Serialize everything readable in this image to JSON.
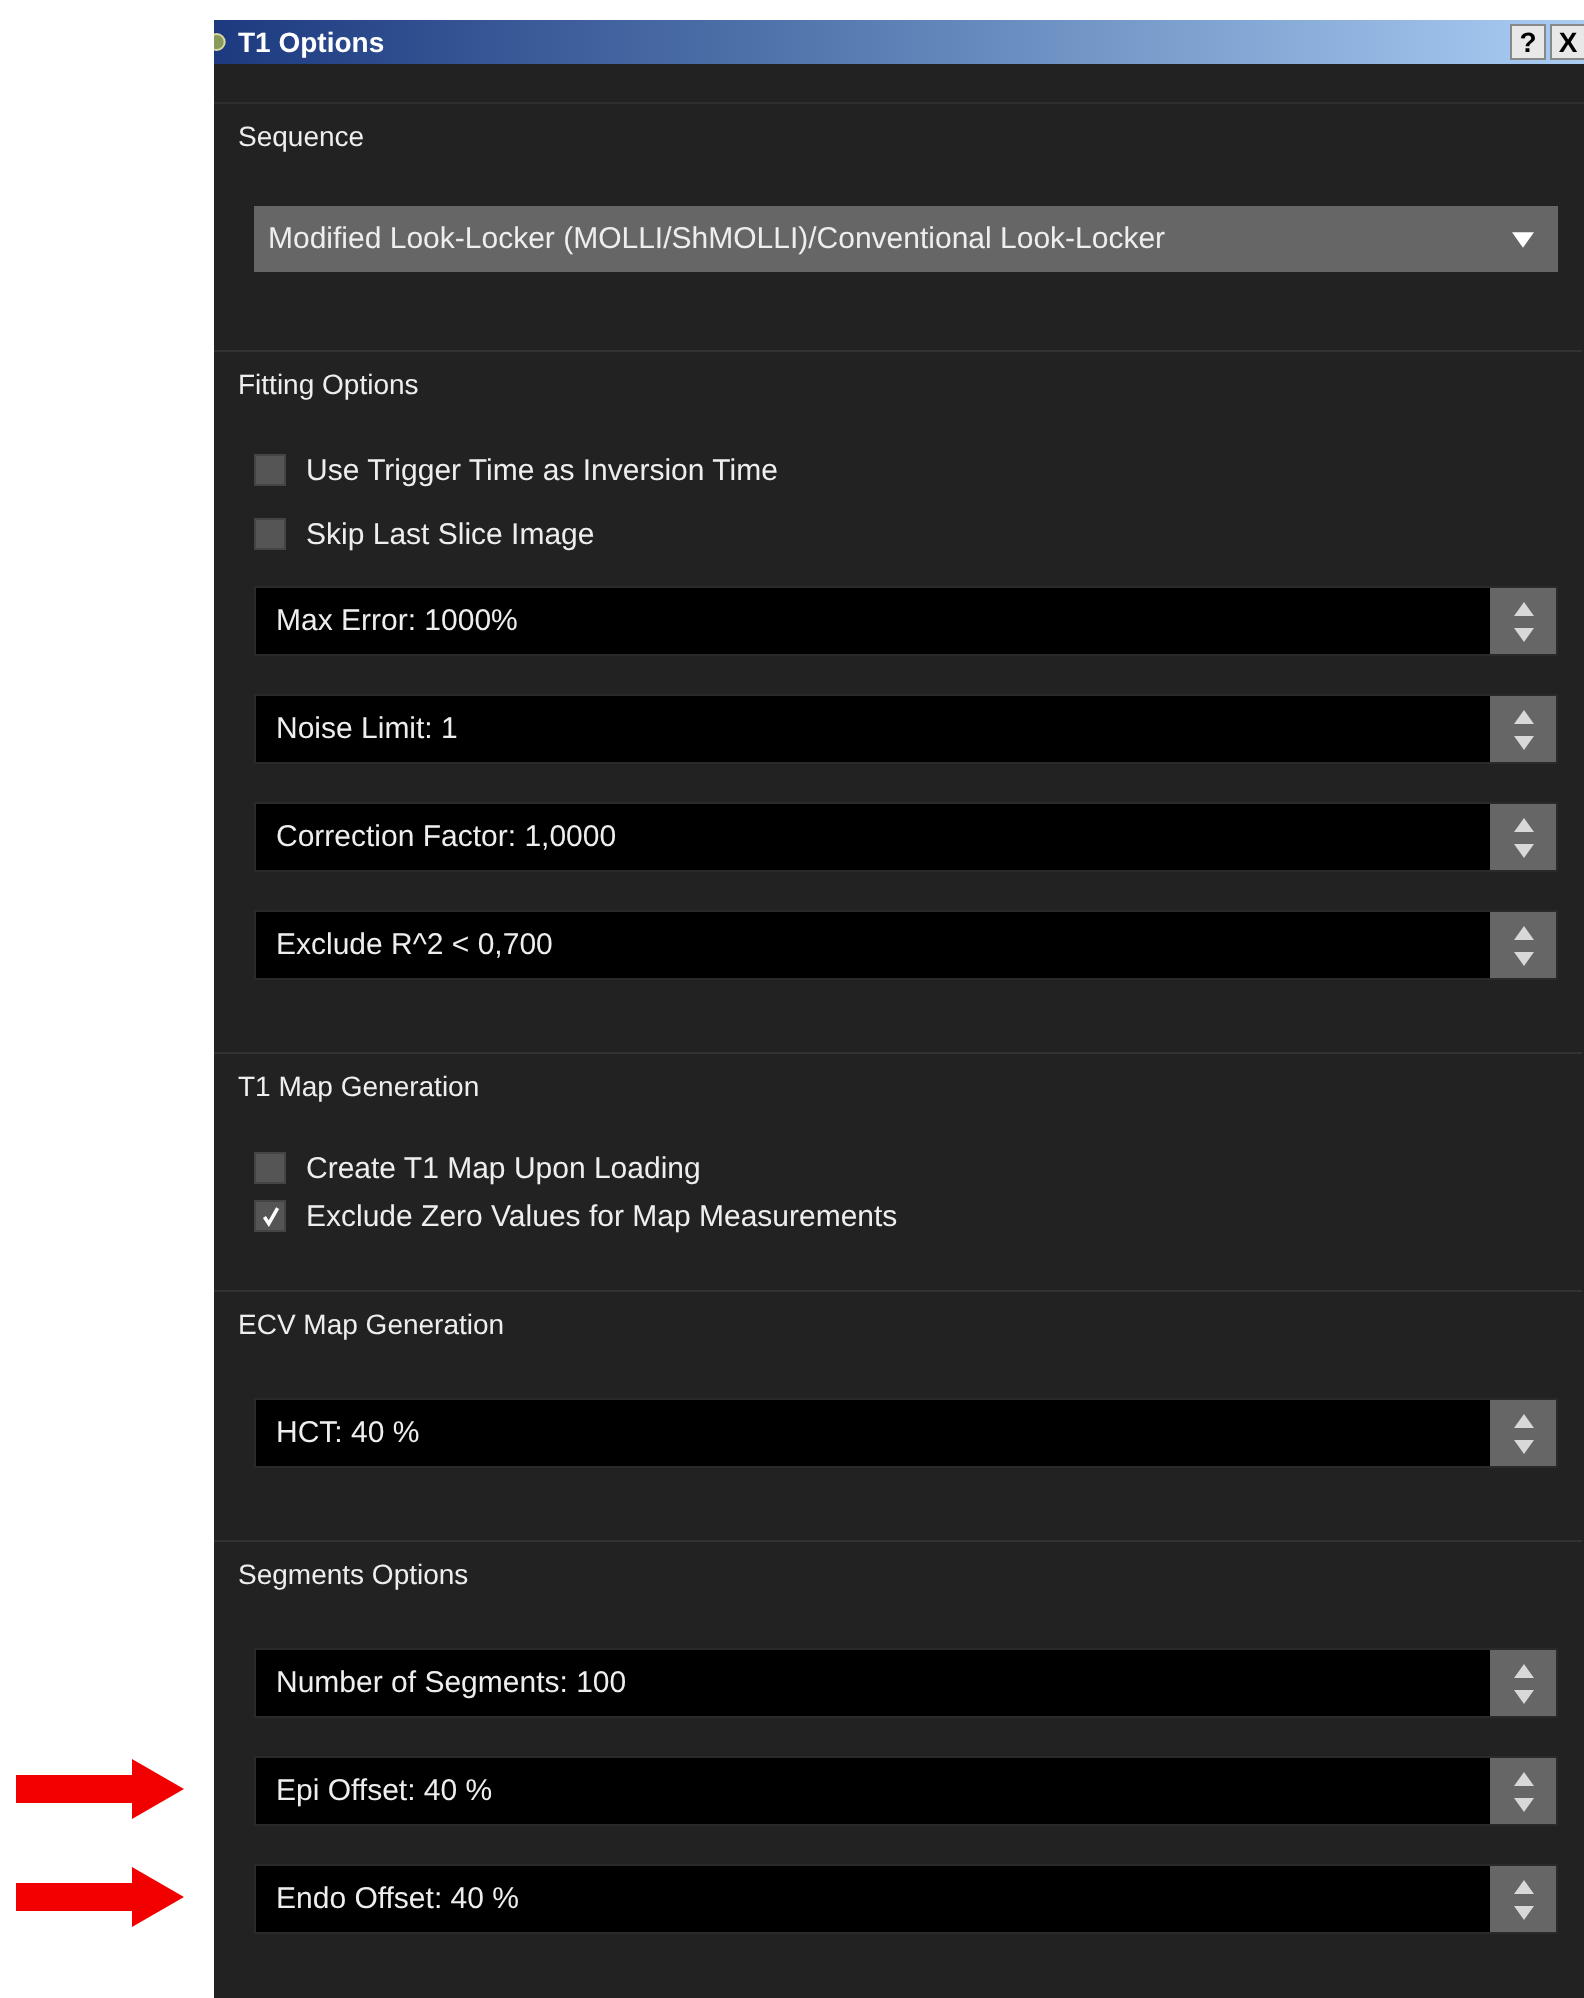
{
  "window": {
    "title": "T1 Options",
    "buttons": [
      "?",
      "X"
    ]
  },
  "sections": [
    {
      "title": "Sequence",
      "items": [
        {
          "kind": "dropdown",
          "value": "Modified Look-Locker (MOLLI/ShMOLLI)/Conventional Look-Locker"
        }
      ]
    },
    {
      "title": "Fitting Options",
      "items": [
        {
          "kind": "checkbox",
          "label": "Use Trigger Time as Inversion Time",
          "checked": false
        },
        {
          "kind": "checkbox",
          "label": "Skip Last Slice Image",
          "checked": false
        },
        {
          "kind": "spinbox",
          "value": "Max Error: 1000%",
          "marked": false
        },
        {
          "kind": "spinbox",
          "value": "Noise Limit: 1",
          "marked": false
        },
        {
          "kind": "spinbox",
          "value": "Correction Factor: 1,0000",
          "marked": false
        },
        {
          "kind": "spinbox",
          "value": "Exclude R^2 < 0,700",
          "marked": false
        }
      ]
    },
    {
      "title": "T1 Map Generation",
      "items": [
        {
          "kind": "checkbox",
          "label": "Create T1 Map Upon Loading",
          "checked": false
        },
        {
          "kind": "checkbox",
          "label": "Exclude Zero Values for Map Measurements",
          "checked": true
        }
      ]
    },
    {
      "title": "ECV Map Generation",
      "items": [
        {
          "kind": "spinbox",
          "value": "HCT:  40 %",
          "marked": false
        }
      ]
    },
    {
      "title": "Segments Options",
      "items": [
        {
          "kind": "spinbox",
          "value": "Number of Segments: 100",
          "marked": false
        },
        {
          "kind": "spinbox",
          "value": "Epi Offset: 40 %",
          "marked": true
        },
        {
          "kind": "spinbox",
          "value": "Endo Offset: 40 %",
          "marked": true
        }
      ]
    }
  ]
}
